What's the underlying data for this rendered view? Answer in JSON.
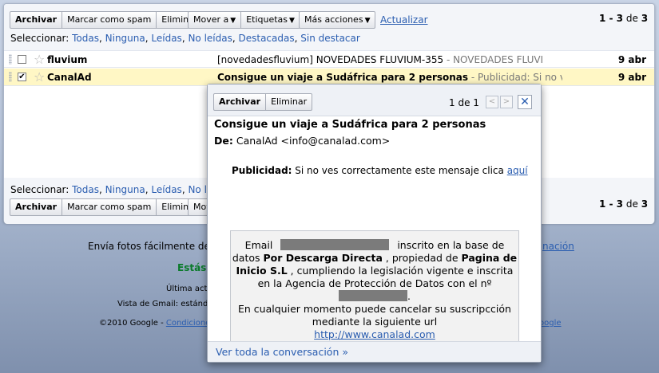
{
  "toolbar": {
    "archive": "Archivar",
    "spam": "Marcar como spam",
    "delete": "Eliminar",
    "move": "Mover a",
    "labels": "Etiquetas",
    "more": "Más acciones",
    "refresh": "Actualizar",
    "count_a": "1 - 3",
    "count_of": "de",
    "count_total": "3",
    "bottom_move_partial": "Mov"
  },
  "select": {
    "label": "Seleccionar:",
    "options": [
      "Todas",
      "Ninguna",
      "Leídas",
      "No leídas",
      "Destacadas",
      "Sin destacar"
    ],
    "bottom_partial_last": "No le"
  },
  "messages": [
    {
      "sender": "fluvium",
      "subject": "[novedadesfluvium] NOVEDADES FLUVIUM-355",
      "snippet": " - NOVEDADES FLUVI",
      "date": "9 abr",
      "checked": false
    },
    {
      "sender": "CanalAd",
      "subject": "Consigue un viaje a Sudáfrica para 2 personas",
      "snippet": " - Publicidad: Si no ves",
      "date": "9 abr",
      "checked": true
    }
  ],
  "footer": {
    "line1": "Envía fotos fácilmente des",
    "line1_right": "nación",
    "line2": "Estás",
    "line3": "Última activ",
    "line4": "Vista de Gmail: estánda",
    "line5_a": "©2010 Google - ",
    "line5_link": "Condicione",
    "line5_right": "oogle"
  },
  "popup": {
    "archive": "Archivar",
    "delete": "Eliminar",
    "counter": "1 de 1",
    "prev": "<",
    "next": ">",
    "close": "✕",
    "subject": "Consigue un viaje a Sudáfrica para 2 personas",
    "from_label": "De:",
    "from_value": "CanalAd <info@canalad.com>",
    "ad_label": "Publicidad:",
    "ad_text": " Si no ves correctamente este mensaje clica ",
    "ad_link": "aquí",
    "body_email": "Email",
    "body_t1": " inscrito en la base de datos ",
    "body_b1": "Por Descarga Directa",
    "body_t2": " , propiedad de ",
    "body_b2": "Pagina de Inicio S.L",
    "body_t3": " , cumpliendo la legislación vigente e inscrita en la Agencia de Protección de Datos con el nº",
    "body_t4": ".",
    "body_t5": "En cualquier momento puede cancelar su suscripcción mediante la siguiente url",
    "body_url": "http://www.canalad.com",
    "view_all": "Ver toda la conversación »"
  },
  "colors": {
    "link": "#2a5db0",
    "selected_row": "#fff7c5",
    "green_text": "#0a7a2a"
  }
}
